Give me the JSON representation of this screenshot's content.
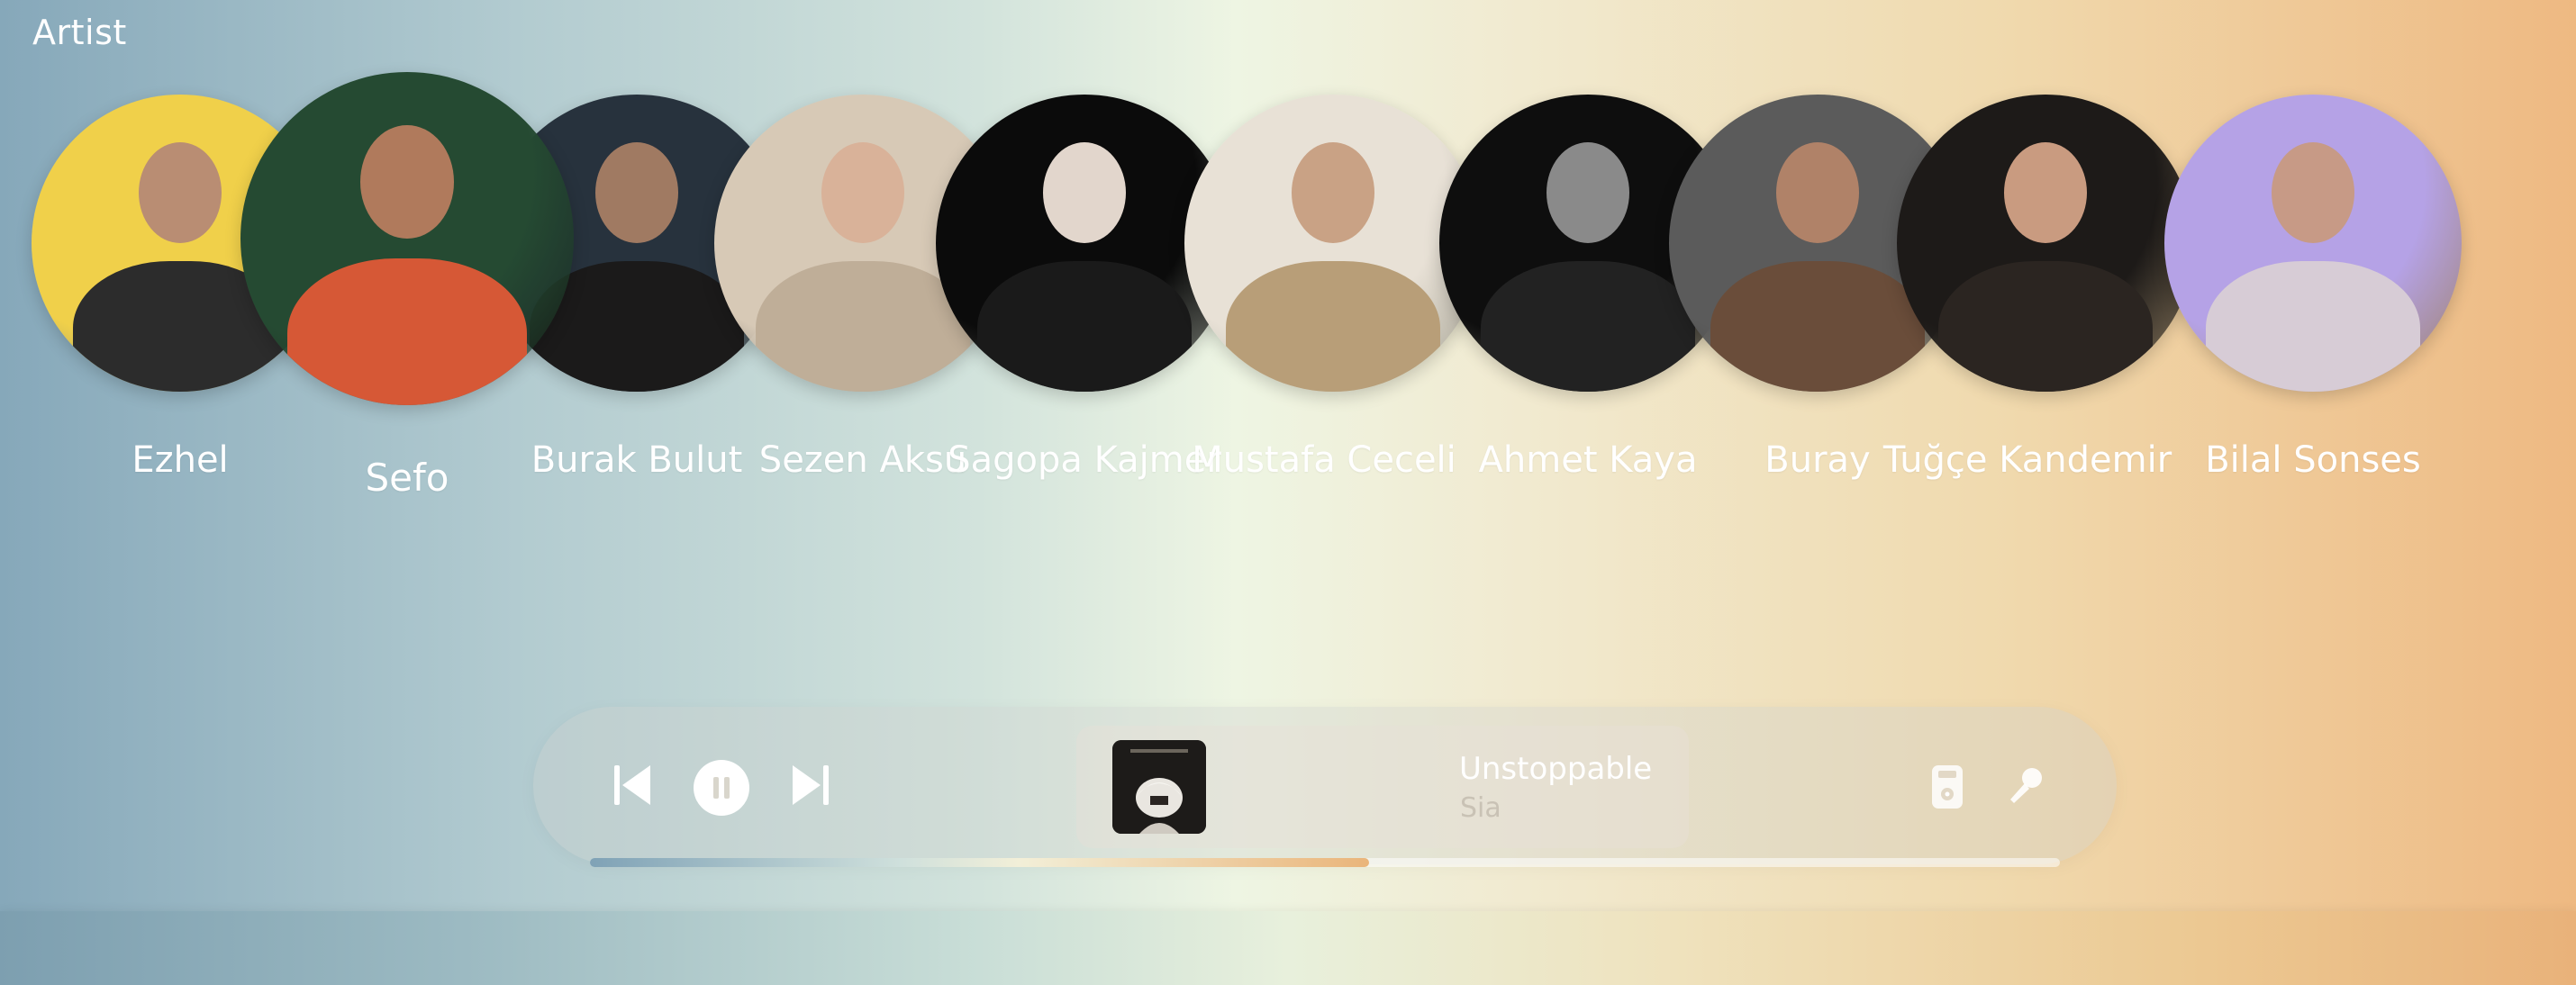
{
  "section": {
    "title": "Artist"
  },
  "artists": [
    {
      "name": "Ezhel",
      "bg": "#f0d04a",
      "skin": "#b98d73",
      "outfit": "#2c2c2c"
    },
    {
      "name": "Sefo",
      "bg": "#254a32",
      "skin": "#b07a5c",
      "outfit": "#d65836"
    },
    {
      "name": "Burak Bulut",
      "bg": "#27323d",
      "skin": "#a07a62",
      "outfit": "#1b1a1a"
    },
    {
      "name": "Sezen Aksu",
      "bg": "#d7c9b6",
      "skin": "#d9b299",
      "outfit": "#bfae98"
    },
    {
      "name": "Sagopa Kajmer",
      "bg": "#0b0b0b",
      "skin": "#e2d6cc",
      "outfit": "#1a1a1a"
    },
    {
      "name": "Mustafa Ceceli",
      "bg": "#e8e1d6",
      "skin": "#c9a285",
      "outfit": "#b89e78"
    },
    {
      "name": "Ahmet Kaya",
      "bg": "#0e0e0e",
      "skin": "#8a8a8a",
      "outfit": "#222222"
    },
    {
      "name": "Buray",
      "bg": "#5b5b5b",
      "skin": "#b08268",
      "outfit": "#6a4d3a"
    },
    {
      "name": "Tuğçe Kandemir",
      "bg": "#1d1a18",
      "skin": "#c99b80",
      "outfit": "#2b2521"
    },
    {
      "name": "Bilal Sonses",
      "bg": "#b5a2e6",
      "skin": "#c79a86",
      "outfit": "#d7ccd6"
    }
  ],
  "player": {
    "title": "Unstoppable",
    "artist": "Sia",
    "progress": 0.53,
    "state": "playing",
    "icons": {
      "previous": "skip-previous-icon",
      "playpause": "pause-icon",
      "next": "skip-next-icon",
      "device": "speaker-icon",
      "lyrics": "microphone-icon"
    }
  }
}
